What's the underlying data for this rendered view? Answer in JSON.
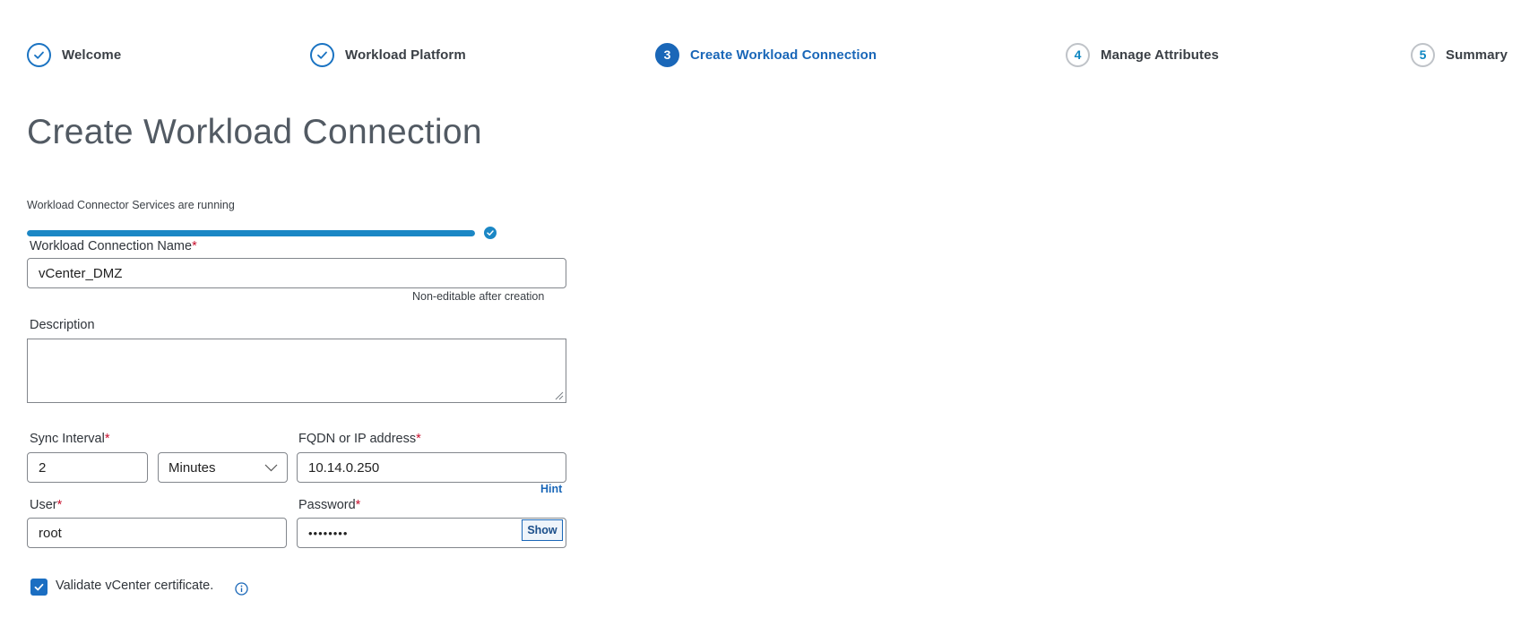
{
  "steps": [
    {
      "number": "",
      "label": "Welcome",
      "state": "done"
    },
    {
      "number": "",
      "label": "Workload Platform",
      "state": "done"
    },
    {
      "number": "3",
      "label": "Create Workload Connection",
      "state": "active"
    },
    {
      "number": "4",
      "label": "Manage Attributes",
      "state": "pending"
    },
    {
      "number": "5",
      "label": "Summary",
      "state": "pending"
    }
  ],
  "page": {
    "title": "Create Workload Connection"
  },
  "status": {
    "text": "Workload Connector Services are running",
    "progress_percent": 100
  },
  "form": {
    "connection_name": {
      "label": "Workload Connection Name",
      "required_mark": "*",
      "value": "vCenter_DMZ",
      "note": "Non-editable after creation"
    },
    "description": {
      "label": "Description",
      "value": ""
    },
    "sync_interval": {
      "label": "Sync Interval",
      "required_mark": "*",
      "value": "2",
      "unit": "Minutes"
    },
    "fqdn": {
      "label": "FQDN or IP address",
      "required_mark": "*",
      "value": "10.14.0.250",
      "hint": "Hint"
    },
    "user": {
      "label": "User",
      "required_mark": "*",
      "value": "root"
    },
    "password": {
      "label": "Password",
      "required_mark": "*",
      "value": "••••••••",
      "show_label": "Show"
    },
    "validate_cert": {
      "label": "Validate vCenter certificate.",
      "checked": true
    }
  },
  "colors": {
    "accent": "#1a67b8",
    "progress": "#1b87c5",
    "required": "#c8102e"
  }
}
